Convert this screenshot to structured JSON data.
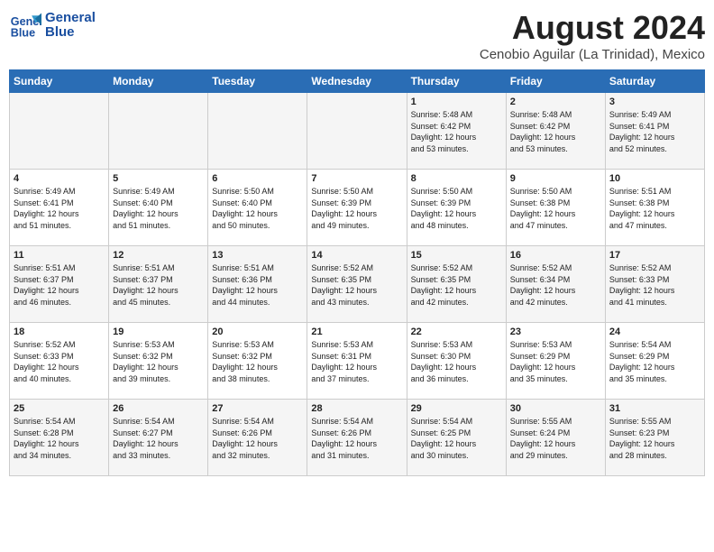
{
  "header": {
    "logo_line1": "General",
    "logo_line2": "Blue",
    "title": "August 2024",
    "subtitle": "Cenobio Aguilar (La Trinidad), Mexico"
  },
  "weekdays": [
    "Sunday",
    "Monday",
    "Tuesday",
    "Wednesday",
    "Thursday",
    "Friday",
    "Saturday"
  ],
  "weeks": [
    [
      {
        "day": "",
        "info": ""
      },
      {
        "day": "",
        "info": ""
      },
      {
        "day": "",
        "info": ""
      },
      {
        "day": "",
        "info": ""
      },
      {
        "day": "1",
        "info": "Sunrise: 5:48 AM\nSunset: 6:42 PM\nDaylight: 12 hours\nand 53 minutes."
      },
      {
        "day": "2",
        "info": "Sunrise: 5:48 AM\nSunset: 6:42 PM\nDaylight: 12 hours\nand 53 minutes."
      },
      {
        "day": "3",
        "info": "Sunrise: 5:49 AM\nSunset: 6:41 PM\nDaylight: 12 hours\nand 52 minutes."
      }
    ],
    [
      {
        "day": "4",
        "info": "Sunrise: 5:49 AM\nSunset: 6:41 PM\nDaylight: 12 hours\nand 51 minutes."
      },
      {
        "day": "5",
        "info": "Sunrise: 5:49 AM\nSunset: 6:40 PM\nDaylight: 12 hours\nand 51 minutes."
      },
      {
        "day": "6",
        "info": "Sunrise: 5:50 AM\nSunset: 6:40 PM\nDaylight: 12 hours\nand 50 minutes."
      },
      {
        "day": "7",
        "info": "Sunrise: 5:50 AM\nSunset: 6:39 PM\nDaylight: 12 hours\nand 49 minutes."
      },
      {
        "day": "8",
        "info": "Sunrise: 5:50 AM\nSunset: 6:39 PM\nDaylight: 12 hours\nand 48 minutes."
      },
      {
        "day": "9",
        "info": "Sunrise: 5:50 AM\nSunset: 6:38 PM\nDaylight: 12 hours\nand 47 minutes."
      },
      {
        "day": "10",
        "info": "Sunrise: 5:51 AM\nSunset: 6:38 PM\nDaylight: 12 hours\nand 47 minutes."
      }
    ],
    [
      {
        "day": "11",
        "info": "Sunrise: 5:51 AM\nSunset: 6:37 PM\nDaylight: 12 hours\nand 46 minutes."
      },
      {
        "day": "12",
        "info": "Sunrise: 5:51 AM\nSunset: 6:37 PM\nDaylight: 12 hours\nand 45 minutes."
      },
      {
        "day": "13",
        "info": "Sunrise: 5:51 AM\nSunset: 6:36 PM\nDaylight: 12 hours\nand 44 minutes."
      },
      {
        "day": "14",
        "info": "Sunrise: 5:52 AM\nSunset: 6:35 PM\nDaylight: 12 hours\nand 43 minutes."
      },
      {
        "day": "15",
        "info": "Sunrise: 5:52 AM\nSunset: 6:35 PM\nDaylight: 12 hours\nand 42 minutes."
      },
      {
        "day": "16",
        "info": "Sunrise: 5:52 AM\nSunset: 6:34 PM\nDaylight: 12 hours\nand 42 minutes."
      },
      {
        "day": "17",
        "info": "Sunrise: 5:52 AM\nSunset: 6:33 PM\nDaylight: 12 hours\nand 41 minutes."
      }
    ],
    [
      {
        "day": "18",
        "info": "Sunrise: 5:52 AM\nSunset: 6:33 PM\nDaylight: 12 hours\nand 40 minutes."
      },
      {
        "day": "19",
        "info": "Sunrise: 5:53 AM\nSunset: 6:32 PM\nDaylight: 12 hours\nand 39 minutes."
      },
      {
        "day": "20",
        "info": "Sunrise: 5:53 AM\nSunset: 6:32 PM\nDaylight: 12 hours\nand 38 minutes."
      },
      {
        "day": "21",
        "info": "Sunrise: 5:53 AM\nSunset: 6:31 PM\nDaylight: 12 hours\nand 37 minutes."
      },
      {
        "day": "22",
        "info": "Sunrise: 5:53 AM\nSunset: 6:30 PM\nDaylight: 12 hours\nand 36 minutes."
      },
      {
        "day": "23",
        "info": "Sunrise: 5:53 AM\nSunset: 6:29 PM\nDaylight: 12 hours\nand 35 minutes."
      },
      {
        "day": "24",
        "info": "Sunrise: 5:54 AM\nSunset: 6:29 PM\nDaylight: 12 hours\nand 35 minutes."
      }
    ],
    [
      {
        "day": "25",
        "info": "Sunrise: 5:54 AM\nSunset: 6:28 PM\nDaylight: 12 hours\nand 34 minutes."
      },
      {
        "day": "26",
        "info": "Sunrise: 5:54 AM\nSunset: 6:27 PM\nDaylight: 12 hours\nand 33 minutes."
      },
      {
        "day": "27",
        "info": "Sunrise: 5:54 AM\nSunset: 6:26 PM\nDaylight: 12 hours\nand 32 minutes."
      },
      {
        "day": "28",
        "info": "Sunrise: 5:54 AM\nSunset: 6:26 PM\nDaylight: 12 hours\nand 31 minutes."
      },
      {
        "day": "29",
        "info": "Sunrise: 5:54 AM\nSunset: 6:25 PM\nDaylight: 12 hours\nand 30 minutes."
      },
      {
        "day": "30",
        "info": "Sunrise: 5:55 AM\nSunset: 6:24 PM\nDaylight: 12 hours\nand 29 minutes."
      },
      {
        "day": "31",
        "info": "Sunrise: 5:55 AM\nSunset: 6:23 PM\nDaylight: 12 hours\nand 28 minutes."
      }
    ]
  ]
}
